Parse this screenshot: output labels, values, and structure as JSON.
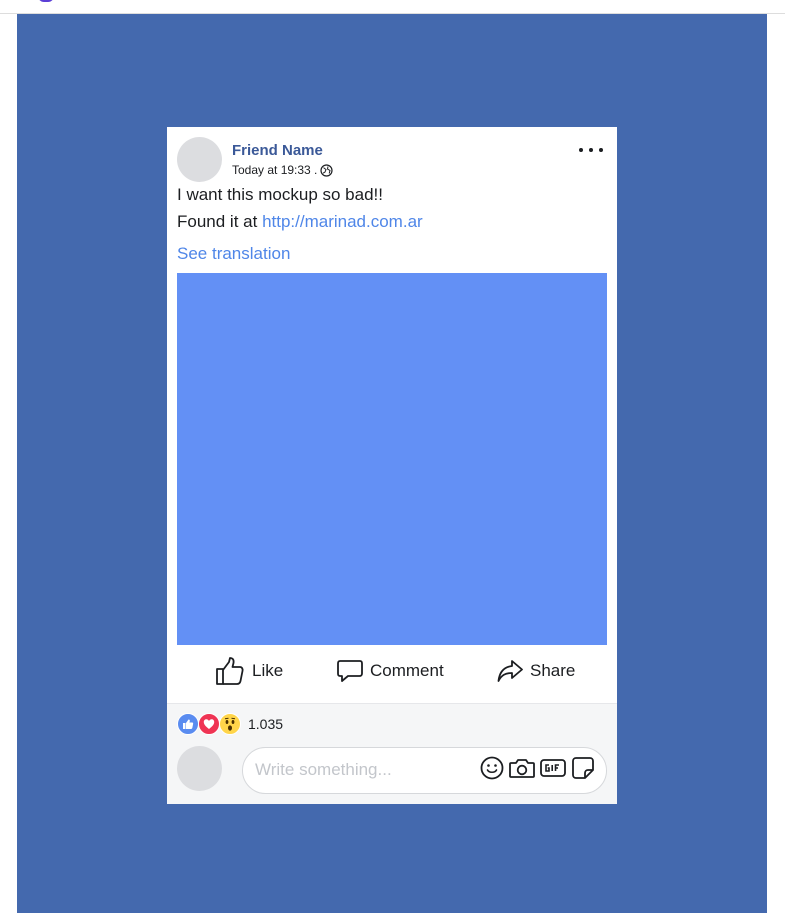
{
  "post": {
    "author": "Friend Name",
    "timestamp": "Today at 19:33 .",
    "visibility_icon": "globe-icon",
    "menu_icon": "more-options-icon",
    "body_line1": "I want this mockup so bad!!",
    "body_line2_prefix": "Found it at ",
    "body_link": "http://marinad.com.ar",
    "see_translation": "See translation",
    "media_color": "#6390f5"
  },
  "actions": {
    "like": {
      "label": "Like",
      "icon": "thumbs-up-icon"
    },
    "comment": {
      "label": "Comment",
      "icon": "comment-icon"
    },
    "share": {
      "label": "Share",
      "icon": "share-icon"
    }
  },
  "reactions": {
    "icons": [
      "like-reaction-icon",
      "love-reaction-icon",
      "wow-reaction-icon"
    ],
    "count": "1.035"
  },
  "composer": {
    "placeholder": "Write something...",
    "tools": [
      "emoji-icon",
      "camera-icon",
      "gif-icon",
      "sticker-icon"
    ]
  },
  "colors": {
    "background": "#4469ae",
    "accent": "#3b5998",
    "link": "#4f86e8"
  }
}
